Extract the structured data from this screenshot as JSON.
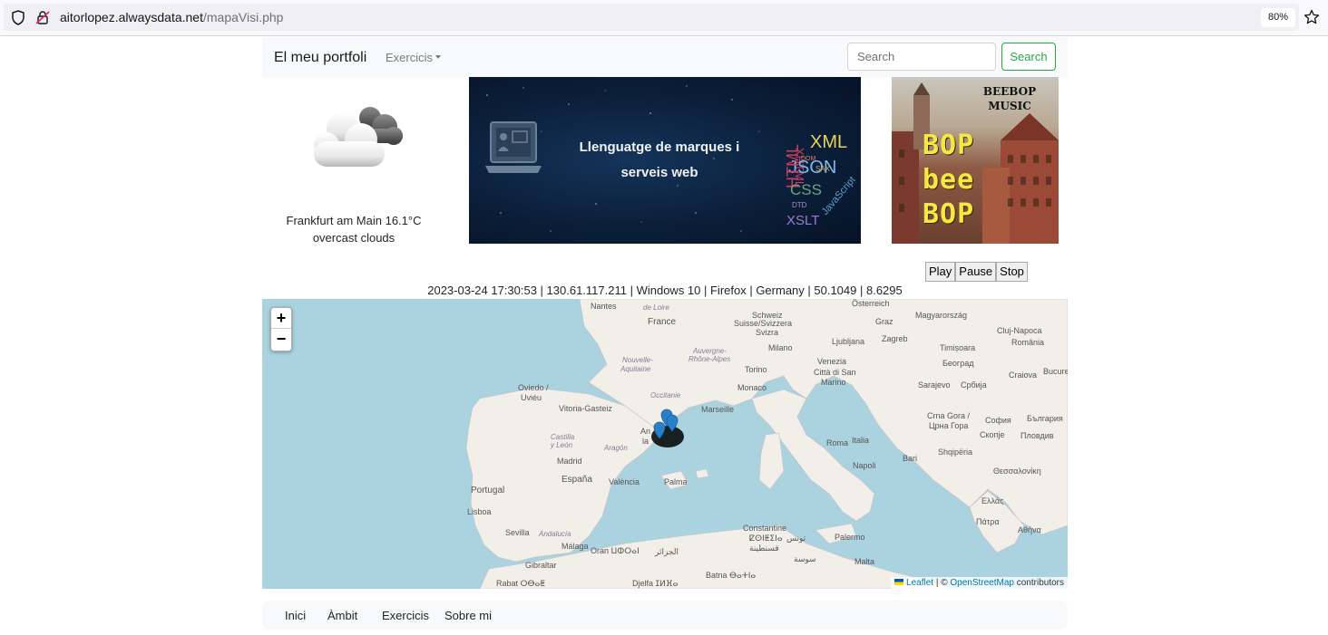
{
  "browser": {
    "url_domain": "aitorlopez.alwaysdata.net",
    "url_path": "/mapaVisi.php",
    "zoom": "80%"
  },
  "navbar": {
    "brand": "El meu portfoli",
    "dropdown_label": "Exercicis",
    "search_placeholder": "Search",
    "search_button": "Search"
  },
  "weather": {
    "line1": "Frankfurt am Main 16.1°C",
    "line2": "overcast clouds",
    "icon": "overcast-clouds-icon"
  },
  "banner": {
    "line1": "Llenguatge de marques i",
    "line2": "serveis web",
    "wordcloud": [
      "XHTML",
      "XML",
      "JSON",
      "HTML",
      "CSS",
      "JavaScript",
      "XSLT",
      "DTD",
      "SAX",
      "DOM"
    ]
  },
  "poster": {
    "label_line1": "BEEBOP",
    "label_line2": "MUSIC",
    "word1": "BOP",
    "word2": "bee",
    "word3": "BOP"
  },
  "audio": {
    "play": "Play",
    "pause": "Pause",
    "stop": "Stop"
  },
  "visit_info": "2023-03-24 17:30:53 | 130.61.117.211 | Windows 10 | Firefox | Germany | 50.1049 | 8.6295",
  "map": {
    "zoom_in": "+",
    "zoom_out": "−",
    "attribution_leaflet": "Leaflet",
    "attribution_sep": " | © ",
    "attribution_osm": "OpenStreetMap",
    "attribution_rest": " contributors",
    "labels": {
      "nantes": "Nantes",
      "france": "France",
      "de_loire": "de Loire",
      "nouvelle": "Nouvelle-",
      "aquitaine": "Aquitaine",
      "auvergne": "Auvergne-",
      "rhone": "Rhône-Alpes",
      "oviedo": "Oviedo /",
      "uvieu": "Uviéu",
      "vitoria": "Vitoria-Gasteiz",
      "occitanie": "Occitanie",
      "marseille": "Marseille",
      "monaco": "Monaco",
      "torino": "Torino",
      "milano": "Milano",
      "schweiz": "Schweiz",
      "suisse": "Suisse/Svizzera",
      "svizra": "Svizra",
      "osterreich": "Österreich",
      "graz": "Graz",
      "magyar": "Magyarország",
      "ljubljana": "Ljubljana",
      "zagreb": "Zagreb",
      "venezia": "Venezia",
      "cluj": "Cluj-Napoca",
      "romania": "România",
      "timisoara": "Timișoara",
      "beograd": "Београд",
      "craiova": "Craiova",
      "bucur": "Bucure",
      "citta": "Città di San",
      "marino": "Marino",
      "sarajevo": "Sarajevo",
      "srbija": "Србија",
      "crna_gora": "Crna Gora /",
      "crna_gora2": "Црна Гора",
      "sofia": "София",
      "bulgaria": "България",
      "skopje": "Скопје",
      "plovdiv": "Пловдив",
      "shqiperia": "Shqipëria",
      "italia": "Italia",
      "roma": "Roma",
      "napoli": "Napoli",
      "bari": "Bari",
      "thess": "Θεσσαλονίκη",
      "ellas": "Ελλάς",
      "patra": "Πάτρα",
      "athina": "Αθήνα",
      "palermo": "Palermo",
      "malta": "Malta",
      "castilla": "Castilla",
      "leon": "y León",
      "aragon": "Aragón",
      "madrid": "Madrid",
      "espana": "España",
      "valencia": "València",
      "palma": "Palma",
      "portugal": "Portugal",
      "lisboa": "Lisboa",
      "sevilla": "Sevilla",
      "andalucia": "Andalucía",
      "malaga": "Málaga",
      "oran": "Oran ⵡⵀⵔⴰⵏ",
      "algiers": "الجزائر",
      "constantine": "Constantine",
      "constantine2": "ⵇⵙⵏⵟⵉⵏⴰ",
      "constantine3": "قسنطينة",
      "tunis": "تونس",
      "sousse": "سوسة",
      "gibraltar": "Gibraltar",
      "rabat": "Rabat ⵔⴱⴰⵟ",
      "djelfa": "Djelfa ⵊⵍⴼⴰ",
      "batna": "Batna ⴱⴰⵜⵏⴰ",
      "an": "An",
      "la": "la"
    }
  },
  "footer": {
    "inici": "Inici",
    "ambit": "Àmbit",
    "exercicis": "Exercicis",
    "sobre_mi": "Sobre mi"
  },
  "colors": {
    "sea": "#aad3df",
    "land": "#f2efe9",
    "accent_green": "#28a745",
    "marker_blue": "#2a81cb"
  }
}
